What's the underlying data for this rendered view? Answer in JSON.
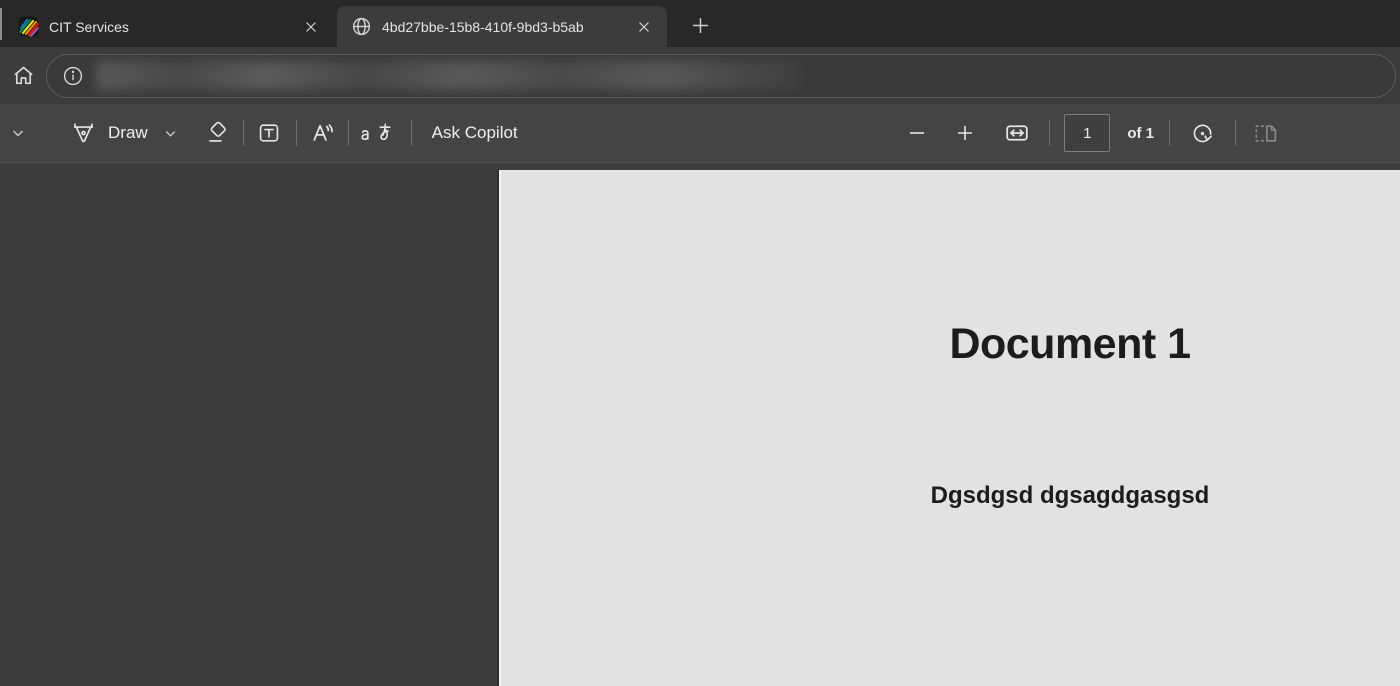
{
  "tabs": [
    {
      "title": "CIT Services",
      "favicon": "cit-rainbow-icon",
      "active": false
    },
    {
      "title": "4bd27bbe-15b8-410f-9bd3-b5ab",
      "favicon": "globe-icon",
      "active": true
    }
  ],
  "tabstrip": {
    "new_tab_icon": "plus-icon"
  },
  "address_bar": {
    "home_icon": "home-icon",
    "info_icon": "info-icon",
    "url_redacted": true
  },
  "pdf_toolbar": {
    "draw_label": "Draw",
    "ask_copilot_label": "Ask Copilot",
    "page_number": "1",
    "page_count_label": "of 1",
    "icons": [
      "chevron-down-icon",
      "pen-icon",
      "eraser-icon",
      "add-text-icon",
      "read-aloud-icon",
      "translate-icon",
      "zoom-out-icon",
      "zoom-in-icon",
      "fit-to-width-icon",
      "rotate-icon",
      "page-view-icon"
    ]
  },
  "document": {
    "title": "Document 1",
    "body": "Dgsdgsd dgsagdgasgsd",
    "current_page": 1,
    "total_pages": 1
  },
  "colors": {
    "tabstrip_bg": "#282828",
    "chrome_bg": "#3c3c3c",
    "toolbar_bg": "#444444",
    "content_bg": "#3d3d3d",
    "page_bg": "#e2e2e2",
    "text_light": "#e5e5e5",
    "text_dark": "#1c1c1c"
  }
}
